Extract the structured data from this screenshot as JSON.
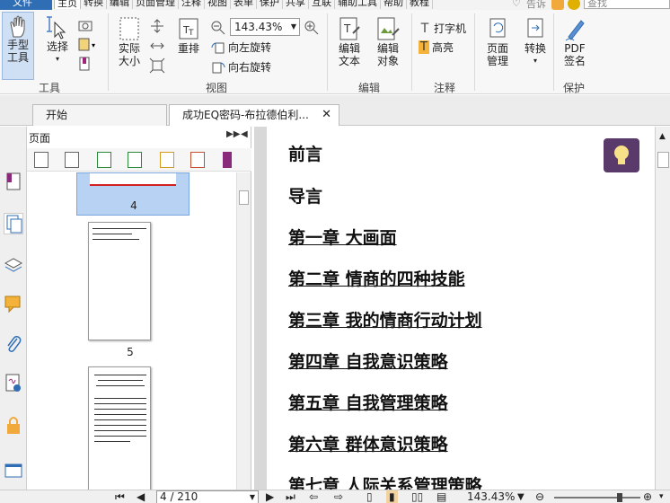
{
  "menubar": {
    "file": "文件",
    "items": [
      "主页",
      "转换",
      "编辑",
      "页面管理",
      "注释",
      "视图",
      "表单",
      "保护",
      "共享",
      "互联",
      "辅助工具",
      "帮助",
      "教程"
    ],
    "tell_me": "告诉",
    "search_placeholder": "查找"
  },
  "ribbon": {
    "hand_label_1": "手型",
    "hand_label_2": "工具",
    "select_label": "选择",
    "actual_size_1": "实际",
    "actual_size_2": "大小",
    "reflow": "重排",
    "zoom_value": "143.43%",
    "rotate_left": "向左旋转",
    "rotate_right": "向右旋转",
    "edit_text_1": "编辑",
    "edit_text_2": "文本",
    "edit_object_1": "编辑",
    "edit_object_2": "对象",
    "typewriter": "打字机",
    "highlight": "高亮",
    "page_mgmt_1": "页面",
    "page_mgmt_2": "管理",
    "convert": "转换",
    "pdf_sign_1": "PDF",
    "pdf_sign_2": "签名",
    "groups": {
      "tools": "工具",
      "view": "视图",
      "edit": "编辑",
      "comment": "注释",
      "protect": "保护"
    }
  },
  "tabs": [
    {
      "label": "开始"
    },
    {
      "label": "成功EQ密码-布拉德伯利..."
    }
  ],
  "panel": {
    "title": "页面",
    "thumb_numbers": [
      "4",
      "5"
    ]
  },
  "document": {
    "toc": [
      "前言",
      "导言",
      "第一章  大画面",
      "第二章  情商的四种技能",
      "第三章  我的情商行动计划",
      "第四章  自我意识策略",
      "第五章  自我管理策略",
      "第六章  群体意识策略",
      "第七章  人际关系管理策略"
    ]
  },
  "status": {
    "page_display": "4 / 210",
    "zoom": "143.43%"
  },
  "colors": {
    "accent": "#2f6db5",
    "bulb": "#5a3a6a",
    "thumb_selected": "#b7d2f2"
  }
}
